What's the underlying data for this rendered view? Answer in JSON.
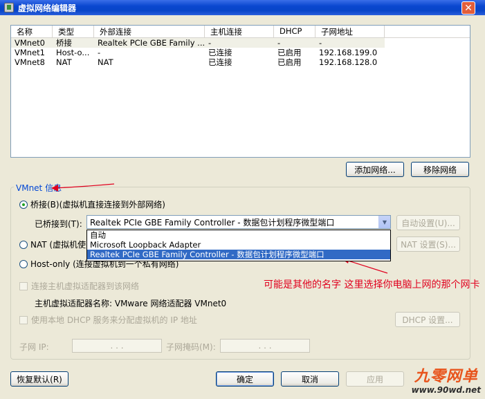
{
  "window": {
    "title": "虚拟网络编辑器",
    "close": "✕"
  },
  "list": {
    "columns": [
      "名称",
      "类型",
      "外部连接",
      "主机连接",
      "DHCP",
      "子网地址"
    ],
    "rows": [
      [
        "VMnet0",
        "桥接",
        "Realtek PCIe GBE Family ...",
        "-",
        "-",
        "-"
      ],
      [
        "VMnet1",
        "Host-o...",
        "-",
        "已连接",
        "已启用",
        "192.168.199.0"
      ],
      [
        "VMnet8",
        "NAT",
        "NAT",
        "已连接",
        "已启用",
        "192.168.128.0"
      ]
    ]
  },
  "buttons": {
    "add_network": "添加网络...",
    "remove_network": "移除网络",
    "auto_settings": "自动设置(U)...",
    "nat_settings": "NAT 设置(S)...",
    "dhcp_settings": "DHCP 设置...",
    "restore_default": "恢复默认(R)",
    "ok": "确定",
    "cancel": "取消",
    "apply": "应用"
  },
  "vmnet_info": {
    "title": "VMnet 信息",
    "bridge_radio": "桥接(B)(虚拟机直接连接到外部网络)",
    "bridged_to_label": "已桥接到(T):",
    "bridged_to_value": "Realtek PCIe GBE Family Controller - 数据包计划程序微型端口",
    "dropdown_options": [
      "自动",
      "Microsoft Loopback Adapter",
      "Realtek PCIe GBE Family Controller - 数据包计划程序微型端口"
    ],
    "nat_radio": "NAT (虚拟机使",
    "hostonly_radio": "Host-only (连接虚拟机到一个私有网络)",
    "connect_adapter": "连接主机虚拟适配器到该网络",
    "adapter_name": "主机虚拟适配器名称: VMware 网络适配器 VMnet0",
    "use_dhcp": "使用本地 DHCP 服务来分配虚拟机的 IP 地址",
    "subnet_ip_label": "子网 IP:",
    "subnet_mask_label": "子网掩码(M):",
    "ip_dots": ".  .  ."
  },
  "annotation": {
    "text": "可能是其他的名字 这里选择你电脑上网的那个网卡"
  },
  "watermark": {
    "brand": "九零网单",
    "url": "www.90wd.net"
  }
}
